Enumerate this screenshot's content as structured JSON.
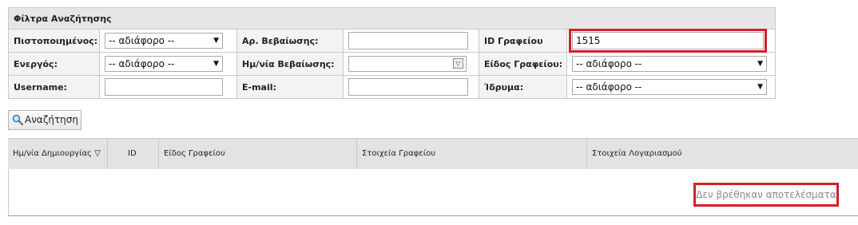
{
  "filters": {
    "title": "Φίλτρα Αναζήτησης",
    "certified_label": "Πιστοποιημένος:",
    "certified_value": "-- αδιάφορο --",
    "cert_no_label": "Αρ. Βεβαίωσης:",
    "cert_no_value": "",
    "office_id_label": "ID Γραφείου",
    "office_id_value": "1515",
    "active_label": "Ενεργός:",
    "active_value": "-- αδιάφορο --",
    "cert_date_label": "Ημ/νία Βεβαίωσης:",
    "cert_date_value": "",
    "office_type_label": "Είδος Γραφείου:",
    "office_type_value": "-- αδιάφορο --",
    "username_label": "Username:",
    "username_value": "",
    "email_label": "E-mail:",
    "email_value": "",
    "institution_label": "Ίδρυμα:",
    "institution_value": "-- αδιάφορο --"
  },
  "search_button": {
    "label": "Αναζήτηση"
  },
  "grid": {
    "columns": [
      "Ημ/νία Δημιουργίας ▽",
      "ID",
      "Είδος Γραφείου",
      "Στοιχεία Γραφείου",
      "Στοιχεία Λογαριασμού"
    ],
    "empty_message": "Δεν βρέθηκαν αποτελέσματα"
  },
  "colors": {
    "highlight": "#d21f2b",
    "header_bg": "#e6e6e6"
  }
}
